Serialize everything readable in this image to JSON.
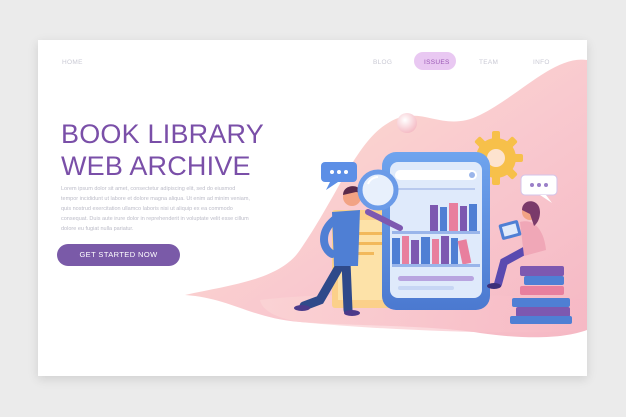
{
  "nav": {
    "home": "HOME",
    "blog": "BLOG",
    "issues": "ISSUES",
    "team": "TEAM",
    "info": "INFO",
    "active": "ISSUES"
  },
  "hero": {
    "title_line1": "BOOK LIBRARY",
    "title_line2": "WEB ARCHIVE",
    "paragraph": "Lorem ipsum dolor sit amet, consectetur adipiscing elit, sed do eiusmod tempor incididunt ut labore et dolore magna aliqua. Ut enim ad minim veniam, quis nostrud exercitation ullamco laboris nisi ut aliquip ex ea commodo consequat. Duis aute irure dolor in reprehenderit in voluptate velit esse cillum dolore eu fugiat nulla pariatur.",
    "cta_label": "GET STARTED NOW"
  },
  "colors": {
    "primary": "#7a4fa8",
    "button": "#7a5aa8",
    "nav_pill": "#e9c8f2",
    "blob_pink": "#f7c1c8",
    "blob_peach": "#fbdcc4",
    "book_blue": "#4f7fd4",
    "book_purple": "#7d58b0",
    "book_pink": "#e87f9e",
    "gear_yellow": "#f7c04a"
  },
  "icons": {
    "magnifier": "magnifier-icon",
    "chat": "chat-bubble-icon",
    "gear": "gear-icon"
  }
}
